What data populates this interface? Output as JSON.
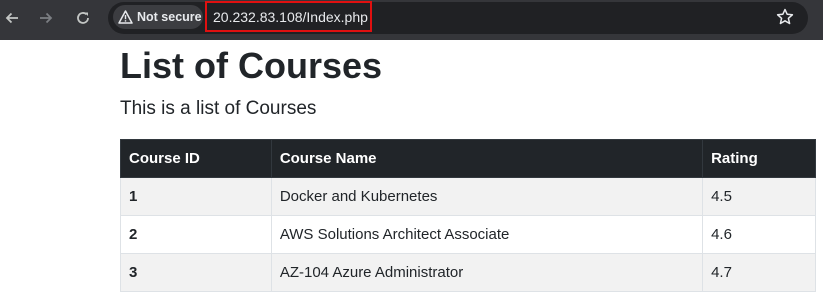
{
  "browser": {
    "security_label": "Not secure",
    "url": "20.232.83.108/Index.php",
    "highlight_color": "#e01010",
    "icons": [
      "back-icon",
      "forward-icon",
      "reload-icon",
      "warning-icon",
      "bookmark-star-icon"
    ]
  },
  "page": {
    "title": "List of Courses",
    "lead": "This is a list of Courses"
  },
  "table": {
    "headers": [
      "Course ID",
      "Course Name",
      "Rating"
    ],
    "rows": [
      [
        "1",
        "Docker and Kubernetes",
        "4.5"
      ],
      [
        "2",
        "AWS Solutions Architect Associate",
        "4.6"
      ],
      [
        "3",
        "AZ-104 Azure Administrator",
        "4.7"
      ]
    ]
  }
}
